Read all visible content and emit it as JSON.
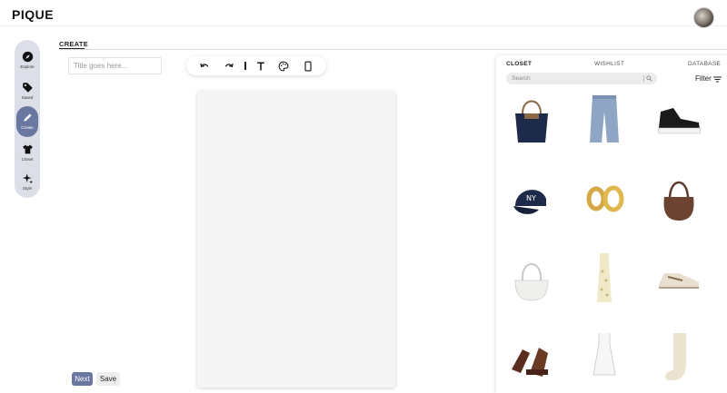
{
  "app": {
    "logo": "PIQUE"
  },
  "nav": {
    "items": [
      {
        "label": "Explore",
        "icon": "compass-icon"
      },
      {
        "label": "Saved",
        "icon": "tag-icon"
      },
      {
        "label": "Create",
        "icon": "pencil-icon",
        "active": true
      },
      {
        "label": "Closet",
        "icon": "shirt-icon"
      },
      {
        "label": "Style",
        "icon": "sparkle-icon"
      }
    ]
  },
  "editor": {
    "tab": "CREATE",
    "title_placeholder": "Title goes here...",
    "title_value": "",
    "toolbar": [
      "undo-icon",
      "redo-icon",
      "text-icon",
      "palette-icon",
      "aspect-ratio-icon"
    ],
    "next_label": "Next",
    "save_label": "Save"
  },
  "panel": {
    "tabs": [
      {
        "label": "CLOSET",
        "active": true
      },
      {
        "label": "WISHLIST",
        "active": false
      },
      {
        "label": "DATABASE",
        "active": false
      }
    ],
    "search_placeholder": "Search",
    "filter_label": "Filter",
    "items": [
      {
        "name": "navy-tote-bag"
      },
      {
        "name": "wide-leg-jeans"
      },
      {
        "name": "black-high-top-sneaker"
      },
      {
        "name": "navy-ny-baseball-cap"
      },
      {
        "name": "gold-hoop-earrings"
      },
      {
        "name": "brown-leather-hobo-bag"
      },
      {
        "name": "white-shoulder-bag"
      },
      {
        "name": "floral-slip-dress"
      },
      {
        "name": "cream-running-sneakers"
      },
      {
        "name": "brown-platform-sandals"
      },
      {
        "name": "white-mini-dress"
      },
      {
        "name": "cream-knit-sock"
      }
    ]
  },
  "colors": {
    "accent": "#6a77a0",
    "nav_bg": "#dcdfe7",
    "canvas": "#f5f5f5"
  }
}
